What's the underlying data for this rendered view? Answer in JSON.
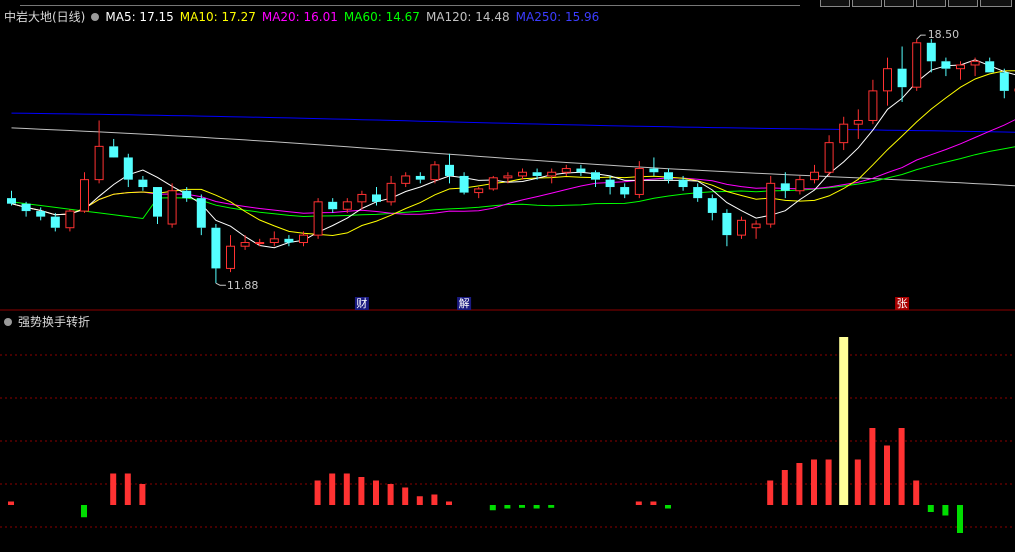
{
  "main_legend": {
    "title": "中岩大地(日线)",
    "ma5": "MA5: 17.15",
    "ma10": "MA10: 17.27",
    "ma20": "MA20: 16.01",
    "ma60": "MA60: 14.67",
    "ma120": "MA120: 14.48",
    "ma250": "MA250: 15.96"
  },
  "sub_legend": {
    "title": "强势换手转折"
  },
  "annotations": {
    "high": "18.50",
    "low": "11.88"
  },
  "markers": [
    "财",
    "解",
    "张"
  ],
  "colors": {
    "up": "#ff3232",
    "down": "#54ffff",
    "ma5": "#ffffff",
    "ma10": "#ffff00",
    "ma20": "#ff00ff",
    "ma60": "#00ff00",
    "ma120": "#c0c0c0",
    "ma250": "#0000ff",
    "grid": "#8b0000"
  },
  "chart_data": [
    {
      "type": "candlestick",
      "title": "中岩大地(日线)",
      "ylim": [
        11.5,
        18.8
      ],
      "candles": [
        [
          14.2,
          14.4,
          14.0,
          14.05
        ],
        [
          14.05,
          14.1,
          13.7,
          13.85
        ],
        [
          13.85,
          13.95,
          13.6,
          13.7
        ],
        [
          13.7,
          13.8,
          13.3,
          13.4
        ],
        [
          13.4,
          13.9,
          13.3,
          13.85
        ],
        [
          13.85,
          14.9,
          13.8,
          14.7
        ],
        [
          14.7,
          16.3,
          14.6,
          15.6
        ],
        [
          15.6,
          15.8,
          15.4,
          15.3
        ],
        [
          15.3,
          15.4,
          14.5,
          14.7
        ],
        [
          14.7,
          14.8,
          14.4,
          14.5
        ],
        [
          14.5,
          14.5,
          13.5,
          13.7
        ],
        [
          13.5,
          14.6,
          13.4,
          14.4
        ],
        [
          14.4,
          14.5,
          14.1,
          14.2
        ],
        [
          14.2,
          14.3,
          13.2,
          13.4
        ],
        [
          13.4,
          13.5,
          11.9,
          12.3
        ],
        [
          12.3,
          13.2,
          12.2,
          12.9
        ],
        [
          12.9,
          13.2,
          12.8,
          13.0
        ],
        [
          13.0,
          13.1,
          12.9,
          13.0
        ],
        [
          13.0,
          13.3,
          12.9,
          13.1
        ],
        [
          13.1,
          13.2,
          12.9,
          13.0
        ],
        [
          13.0,
          13.3,
          12.9,
          13.2
        ],
        [
          13.2,
          14.2,
          13.1,
          14.1
        ],
        [
          14.1,
          14.2,
          13.8,
          13.9
        ],
        [
          13.9,
          14.2,
          13.8,
          14.1
        ],
        [
          14.1,
          14.4,
          13.9,
          14.3
        ],
        [
          14.3,
          14.5,
          14.0,
          14.1
        ],
        [
          14.1,
          14.8,
          14.0,
          14.6
        ],
        [
          14.6,
          14.9,
          14.5,
          14.8
        ],
        [
          14.8,
          14.9,
          14.6,
          14.7
        ],
        [
          14.7,
          15.2,
          14.6,
          15.1
        ],
        [
          15.1,
          15.4,
          14.6,
          14.8
        ],
        [
          14.8,
          14.9,
          14.3,
          14.35
        ],
        [
          14.35,
          14.5,
          14.2,
          14.45
        ],
        [
          14.45,
          14.8,
          14.4,
          14.75
        ],
        [
          14.75,
          14.9,
          14.6,
          14.8
        ],
        [
          14.8,
          15.0,
          14.7,
          14.9
        ],
        [
          14.9,
          15.0,
          14.7,
          14.8
        ],
        [
          14.8,
          15.0,
          14.6,
          14.9
        ],
        [
          14.9,
          15.1,
          14.8,
          15.0
        ],
        [
          15.0,
          15.1,
          14.8,
          14.9
        ],
        [
          14.9,
          14.95,
          14.5,
          14.7
        ],
        [
          14.7,
          14.8,
          14.3,
          14.5
        ],
        [
          14.5,
          14.6,
          14.2,
          14.3
        ],
        [
          14.3,
          15.2,
          14.2,
          15.0
        ],
        [
          15.0,
          15.3,
          14.8,
          14.9
        ],
        [
          14.9,
          15.0,
          14.6,
          14.7
        ],
        [
          14.7,
          14.8,
          14.4,
          14.5
        ],
        [
          14.5,
          14.6,
          14.1,
          14.2
        ],
        [
          14.2,
          14.3,
          13.6,
          13.8
        ],
        [
          13.8,
          13.9,
          12.9,
          13.2
        ],
        [
          13.2,
          13.7,
          13.1,
          13.6
        ],
        [
          13.4,
          13.6,
          13.1,
          13.5
        ],
        [
          13.5,
          14.8,
          13.4,
          14.6
        ],
        [
          14.6,
          14.9,
          14.2,
          14.4
        ],
        [
          14.4,
          14.8,
          14.3,
          14.7
        ],
        [
          14.7,
          15.1,
          14.6,
          14.9
        ],
        [
          14.9,
          15.9,
          14.8,
          15.7
        ],
        [
          15.7,
          16.4,
          15.5,
          16.2
        ],
        [
          16.2,
          16.6,
          15.8,
          16.3
        ],
        [
          16.3,
          17.4,
          16.2,
          17.1
        ],
        [
          17.1,
          18.0,
          16.7,
          17.7
        ],
        [
          17.7,
          18.3,
          16.8,
          17.2
        ],
        [
          17.2,
          18.5,
          17.1,
          18.4
        ],
        [
          18.4,
          18.5,
          17.6,
          17.9
        ],
        [
          17.9,
          18.0,
          17.5,
          17.7
        ],
        [
          17.7,
          17.9,
          17.4,
          17.8
        ],
        [
          17.8,
          18.0,
          17.5,
          17.9
        ],
        [
          17.9,
          18.0,
          17.6,
          17.6
        ],
        [
          17.6,
          17.7,
          16.9,
          17.1
        ],
        [
          17.1,
          17.8,
          17.0,
          17.15
        ]
      ]
    },
    {
      "type": "bar",
      "title": "强势换手转折",
      "ylim": [
        -1.0,
        5.0
      ],
      "values": [
        0.1,
        0,
        0,
        0,
        0,
        -0.35,
        0,
        0.9,
        0.9,
        0.6,
        0,
        0,
        0,
        0,
        0,
        0,
        0,
        0,
        0,
        0,
        0,
        0.7,
        0.9,
        0.9,
        0.8,
        0.7,
        0.6,
        0.5,
        0.25,
        0.3,
        0.1,
        0,
        0,
        -0.15,
        -0.1,
        -0.08,
        -0.1,
        -0.08,
        0,
        0,
        0,
        0,
        0,
        0.1,
        0.1,
        -0.1,
        0,
        0,
        0,
        0,
        0,
        0,
        0.7,
        1.0,
        1.2,
        1.3,
        1.3,
        4.8,
        1.3,
        2.2,
        1.7,
        2.2,
        0.7,
        -0.2,
        -0.3,
        -0.8,
        0,
        0,
        0,
        0
      ],
      "highlight_index": 57
    }
  ]
}
